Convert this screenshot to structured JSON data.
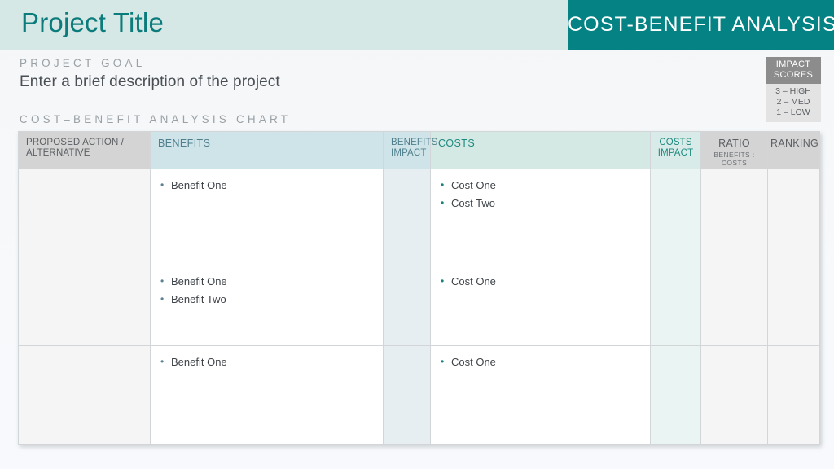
{
  "header": {
    "project_title": "Project Title",
    "accent_title": "COST-BENEFIT ANALYSIS",
    "accent_color": "#048284",
    "title_band_color": "#d6e8e6"
  },
  "goal": {
    "label": "PROJECT GOAL",
    "text": "Enter a brief description of the project"
  },
  "section": {
    "chart_label": "COST–BENEFIT ANALYSIS CHART"
  },
  "legend": {
    "title_line1": "IMPACT",
    "title_line2": "SCORES",
    "scores": [
      "3 – HIGH",
      "2 – MED",
      "1 – LOW"
    ],
    "head_color": "#8c8c8c",
    "body_color": "#e3e3e3"
  },
  "table": {
    "headers": {
      "action_line1": "PROPOSED ACTION /",
      "action_line2": "ALTERNATIVE",
      "benefits": "BENEFITS",
      "benefits_impact_line1": "BENEFITS",
      "benefits_impact_line2": "IMPACT",
      "costs": "COSTS",
      "costs_impact_line1": "COSTS",
      "costs_impact_line2": "IMPACT",
      "ratio": "RATIO",
      "ratio_sub": "BENEFITS : COSTS",
      "ranking": "RANKING"
    },
    "rows": [
      {
        "action": "",
        "benefits": [
          "Benefit One"
        ],
        "benefits_impact": "",
        "costs": [
          "Cost One",
          "Cost Two"
        ],
        "costs_impact": "",
        "ratio": "",
        "ranking": ""
      },
      {
        "action": "",
        "benefits": [
          "Benefit One",
          "Benefit Two"
        ],
        "benefits_impact": "",
        "costs": [
          "Cost One"
        ],
        "costs_impact": "",
        "ratio": "",
        "ranking": ""
      },
      {
        "action": "",
        "benefits": [
          "Benefit One"
        ],
        "benefits_impact": "",
        "costs": [
          "Cost One"
        ],
        "costs_impact": "",
        "ratio": "",
        "ranking": ""
      }
    ]
  }
}
